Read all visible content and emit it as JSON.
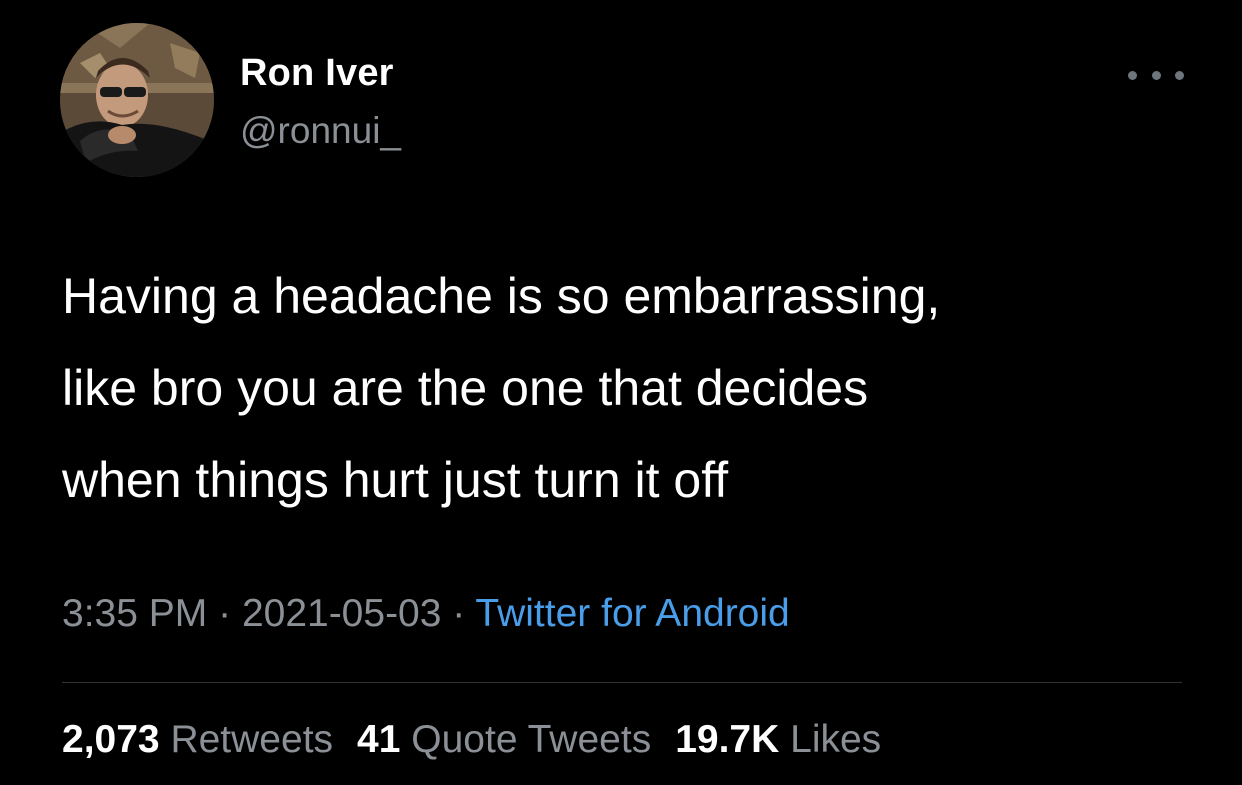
{
  "author": {
    "display_name": "Ron Iver",
    "handle": "@ronnui_",
    "avatar": "profile-photo"
  },
  "more_icon": "ellipsis-icon",
  "tweet": {
    "lines": [
      "Having a headache is so embarrassing,",
      "like bro you are the one that decides",
      "when things hurt just turn it off"
    ]
  },
  "meta": {
    "time": "3:35 PM",
    "separator": "·",
    "date": "2021-05-03",
    "source": "Twitter for Android"
  },
  "stats": {
    "retweets_count": "2,073",
    "retweets_label": "Retweets",
    "quotes_count": "41",
    "quotes_label": "Quote Tweets",
    "likes_count": "19.7K",
    "likes_label": "Likes"
  },
  "colors": {
    "background": "#000000",
    "primary_text": "#ffffff",
    "secondary_text": "#8b9096",
    "link": "#4a9de8",
    "divider": "#2f3336"
  }
}
